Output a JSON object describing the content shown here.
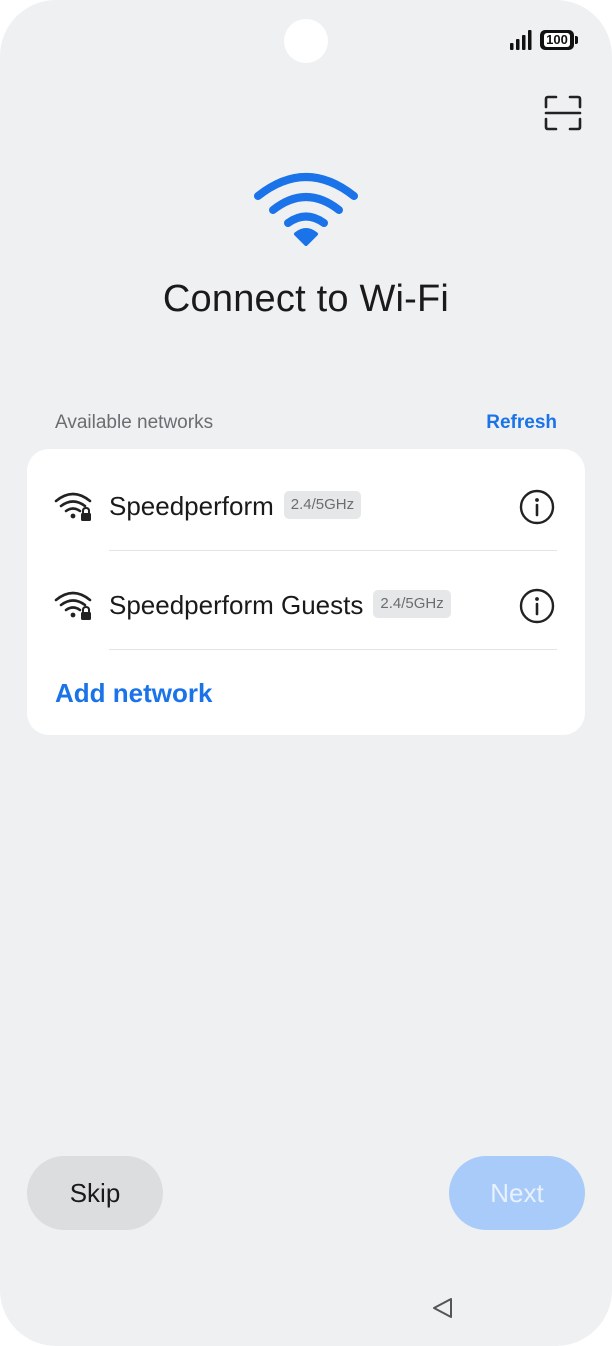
{
  "status_bar": {
    "battery": "100",
    "icons": [
      "signal-icon",
      "battery-icon"
    ]
  },
  "header": {
    "scan_icon": "qr-scan-icon",
    "hero_icon": "wifi-icon",
    "title": "Connect to Wi-Fi"
  },
  "networks_section": {
    "label": "Available networks",
    "refresh_label": "Refresh",
    "items": [
      {
        "name": "Speedperform",
        "band": "2.4/5GHz",
        "icon": "wifi-locked-icon",
        "info_icon": "info-icon"
      },
      {
        "name": "Speedperform Guests",
        "band": "2.4/5GHz",
        "icon": "wifi-locked-icon",
        "info_icon": "info-icon"
      }
    ],
    "add_label": "Add network"
  },
  "footer": {
    "skip_label": "Skip",
    "next_label": "Next"
  },
  "nav": {
    "back_icon": "back-triangle-icon"
  },
  "colors": {
    "accent": "#1a73e8",
    "background": "#eff0f2",
    "card": "#ffffff",
    "next_disabled": "#a9cbf9"
  }
}
